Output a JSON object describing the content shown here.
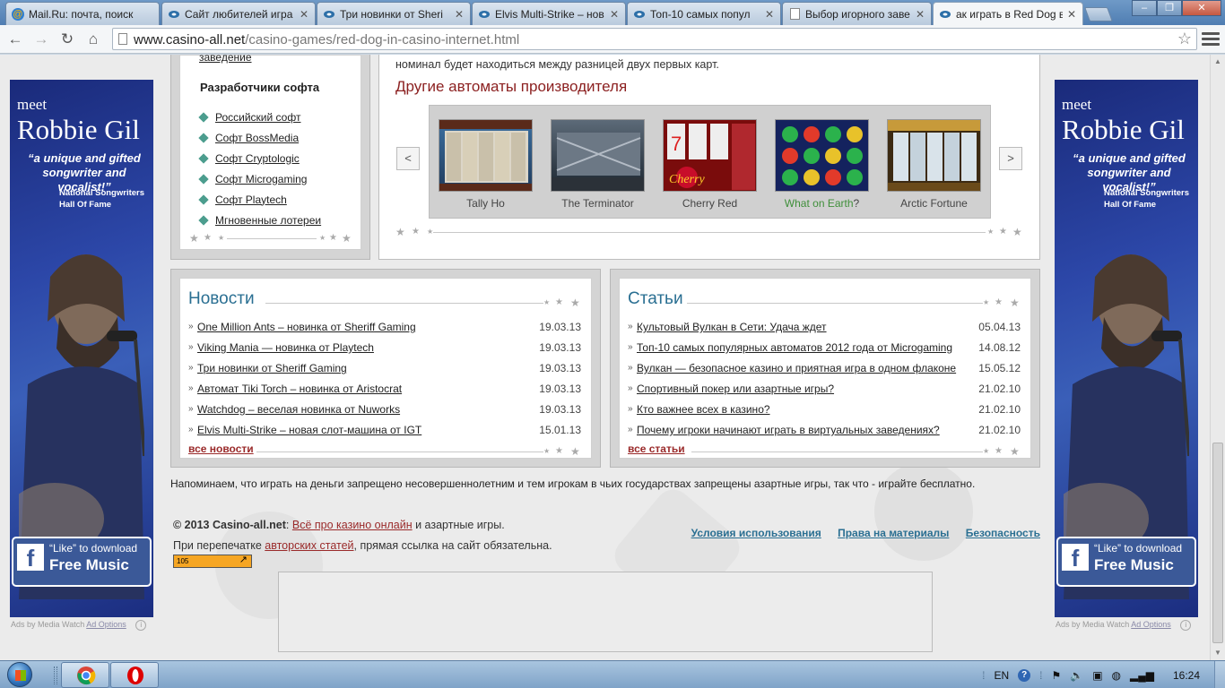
{
  "tabs": [
    {
      "label": "Mail.Ru: почта, поиск",
      "icon": "mail-ru-icon"
    },
    {
      "label": "Сайт любителей игра",
      "icon": "doc-icon"
    },
    {
      "label": "Три новинки от Sheri",
      "icon": "casino-icon"
    },
    {
      "label": "Elvis Multi-Strike – нов",
      "icon": "casino-icon"
    },
    {
      "label": "Топ-10 самых попул",
      "icon": "casino-icon"
    },
    {
      "label": "Выбор игорного заве",
      "icon": "doc-icon"
    },
    {
      "label": "ак играть в Red Dog в",
      "icon": "casino-icon",
      "active": true
    }
  ],
  "window_controls": {
    "minimize": "–",
    "maximize": "❐",
    "close": "✕"
  },
  "toolbar": {
    "back": "←",
    "forward": "→",
    "reload": "↻",
    "home": "⌂",
    "url_host": "www.casino-all.net",
    "url_path": "/casino-games/red-dog-in-casino-internet.html",
    "bookmark_star": "☆"
  },
  "ad": {
    "meet": "meet",
    "name": "Robbie Gil",
    "quote": "“a unique and gifted songwriter and vocalist!”",
    "org_line1": "National Songwriters",
    "org_line2": "Hall Of Fame",
    "like": "“Like” to download",
    "free": "Free Music",
    "fb_letter": "f",
    "footer_text": "Ads by Media Watch",
    "footer_link": "Ad Options",
    "info": "i"
  },
  "sidebar": {
    "cut_link": "заведение",
    "title": "Разработчики софта",
    "items": [
      "Российский софт",
      "Софт BossMedia",
      "Софт Cryptologic",
      "Софт Microgaming",
      "Софт Playtech",
      "Мгновенные лотереи"
    ]
  },
  "content": {
    "top_text": "номинал будет находиться между разницей двух первых карт.",
    "other_title": "Другие автоматы производителя",
    "prev": "<",
    "next": ">",
    "games": [
      {
        "name": "Tally Ho"
      },
      {
        "name": "The Terminator"
      },
      {
        "name": "Cherry Red"
      },
      {
        "name": "What on Earth",
        "suffix": "?"
      },
      {
        "name": "Arctic Fortune"
      }
    ]
  },
  "news": {
    "title": "Новости",
    "items": [
      {
        "text": "One Million Ants – новинка от Sheriff Gaming",
        "date": "19.03.13"
      },
      {
        "text": "Viking Mania — новинка от Playtech",
        "date": "19.03.13"
      },
      {
        "text": "Три новинки от Sheriff Gaming",
        "date": "19.03.13"
      },
      {
        "text": "Автомат Tiki Torch – новинка от Aristocrat",
        "date": "19.03.13"
      },
      {
        "text": "Watchdog – веселая новинка от Nuworks",
        "date": "19.03.13"
      },
      {
        "text": "Elvis Multi-Strike – новая слот-машина от IGT",
        "date": "15.01.13"
      }
    ],
    "all": "все новости"
  },
  "articles": {
    "title": "Статьи",
    "items": [
      {
        "text": "Культовый Вулкан в Сети: Удача ждет",
        "date": "05.04.13"
      },
      {
        "text": "Топ-10 самых популярных автоматов 2012 года от Microgaming",
        "date": "14.08.12"
      },
      {
        "text": "Вулкан — безопасное казино и приятная игра в одном флаконе",
        "date": "15.05.12"
      },
      {
        "text": "Спортивный покер или азартные игры?",
        "date": "21.02.10"
      },
      {
        "text": "Кто важнее всех в казино?",
        "date": "21.02.10"
      },
      {
        "text": "Почему игроки начинают играть в виртуальных заведениях?",
        "date": "21.02.10"
      }
    ],
    "all": "все статьи"
  },
  "footer": {
    "warning": "Напоминаем, что играть на деньги запрещено несовершеннолетним и тем игрокам в чьих государствах запрещены азартные игры, так что - играйте бесплатно.",
    "copyright_prefix": "© 2013 Casino-all.net",
    "colon": ": ",
    "copyright_link": "Всё про казино онлайн",
    "copyright_suffix": " и азартные игры.",
    "reprint_prefix": "При перепечатке ",
    "reprint_link": "авторских статей",
    "reprint_suffix": ", прямая ссылка на сайт обязательна.",
    "links": [
      "Условия использования",
      "Права на материалы",
      "Безопасность"
    ],
    "counter": "105"
  },
  "taskbar": {
    "lang": "EN",
    "help": "?",
    "time": "16:24"
  }
}
